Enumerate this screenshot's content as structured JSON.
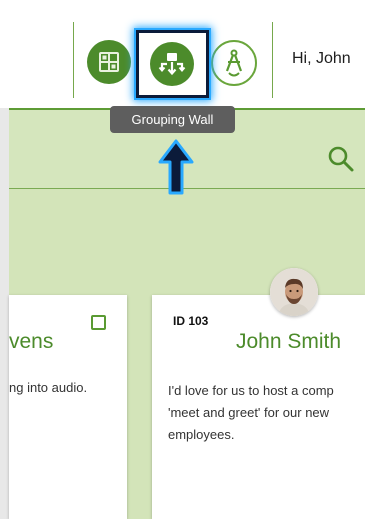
{
  "header": {
    "greeting": "Hi, John",
    "tooltip": "Grouping Wall",
    "icons": [
      "dashboard-grid-icon",
      "grouping-wall-icon",
      "compass-icon"
    ]
  },
  "colors": {
    "brand_green": "#4c8b2b",
    "band_green": "#d5e6bd",
    "wall_green": "#d3e4b9",
    "highlight_blue": "#29a9ff"
  },
  "cards": [
    {
      "name": "vens",
      "text": "ng into audio."
    },
    {
      "id": "ID 103",
      "name": "John Smith",
      "text": "I'd love for us to host a comp\n'meet and greet' for our new\nemployees."
    }
  ]
}
